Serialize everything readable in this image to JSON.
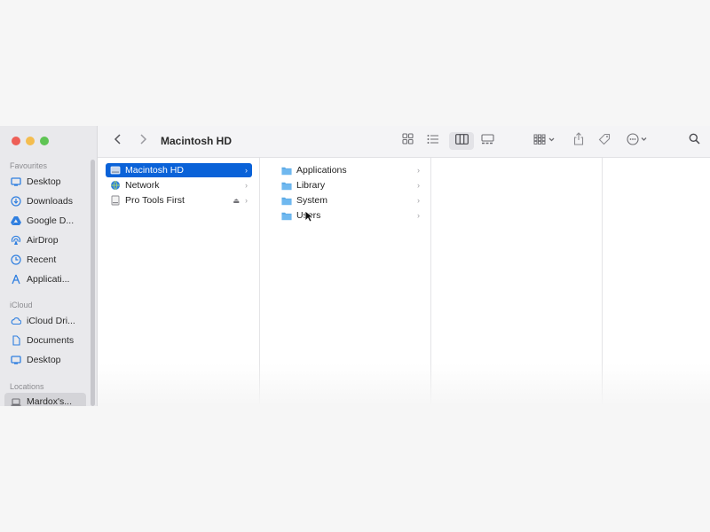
{
  "window": {
    "title": "Macintosh HD"
  },
  "sidebar": {
    "sections": [
      {
        "label": "Favourites",
        "items": [
          {
            "label": "Desktop",
            "icon": "desktop-icon"
          },
          {
            "label": "Downloads",
            "icon": "download-icon"
          },
          {
            "label": "Google D...",
            "icon": "google-drive-icon"
          },
          {
            "label": "AirDrop",
            "icon": "airdrop-icon"
          },
          {
            "label": "Recent",
            "icon": "clock-icon"
          },
          {
            "label": "Applicati...",
            "icon": "applications-icon"
          }
        ]
      },
      {
        "label": "iCloud",
        "items": [
          {
            "label": "iCloud Dri...",
            "icon": "cloud-icon"
          },
          {
            "label": "Documents",
            "icon": "document-icon"
          },
          {
            "label": "Desktop",
            "icon": "desktop-icon"
          }
        ]
      },
      {
        "label": "Locations",
        "items": [
          {
            "label": "Mardox's...",
            "icon": "laptop-icon"
          }
        ]
      }
    ]
  },
  "toolbar": {
    "back_icon": "chevron-left-icon",
    "forward_icon": "chevron-right-icon",
    "view_modes": [
      "icon-view-icon",
      "list-view-icon",
      "column-view-icon",
      "gallery-view-icon"
    ],
    "selected_view": "column-view-icon",
    "actions": [
      "group-icon",
      "share-icon",
      "tag-icon",
      "more-icon",
      "search-icon"
    ]
  },
  "columns": [
    {
      "items": [
        {
          "label": "Macintosh HD",
          "icon": "disk-icon",
          "selected": true
        },
        {
          "label": "Network",
          "icon": "network-icon"
        },
        {
          "label": "Pro Tools First",
          "icon": "volume-icon",
          "ejectable": true
        }
      ]
    },
    {
      "items": [
        {
          "label": "Applications",
          "icon": "folder-icon"
        },
        {
          "label": "Library",
          "icon": "folder-icon"
        },
        {
          "label": "System",
          "icon": "folder-icon"
        },
        {
          "label": "Users",
          "icon": "folder-icon"
        }
      ]
    }
  ],
  "colors": {
    "selection": "#0a62d8",
    "folder": "#5aa9e6",
    "sidebar_icon": "#2f7fe0"
  }
}
